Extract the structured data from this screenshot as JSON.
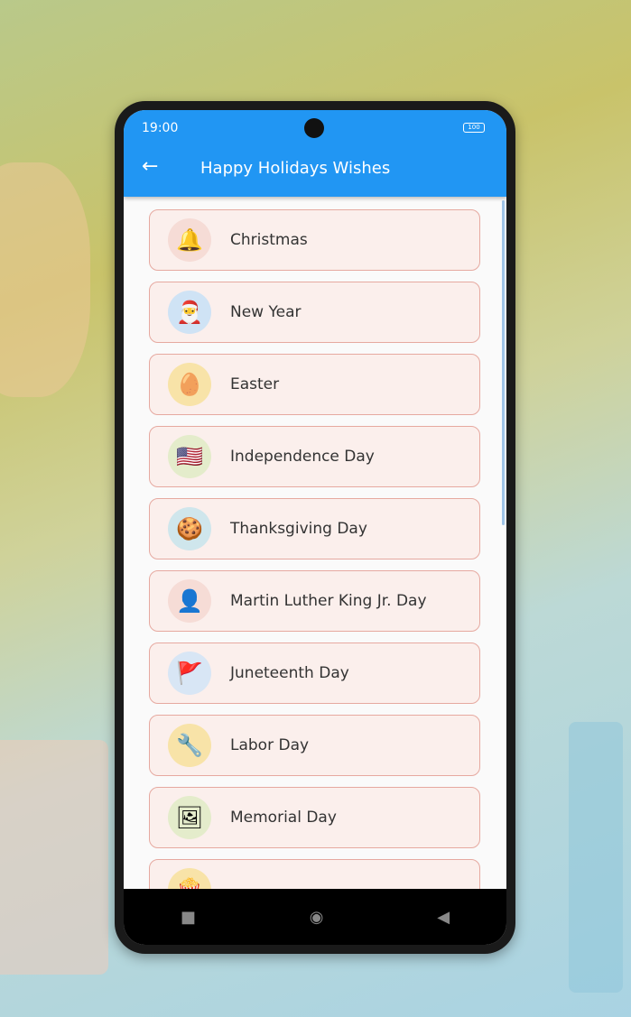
{
  "status_bar": {
    "time": "19:00",
    "battery": "100"
  },
  "app_bar": {
    "title": "Happy Holidays Wishes",
    "back_icon": "arrow-left-icon"
  },
  "colors": {
    "primary": "#2196F3",
    "card_bg": "#fbefec",
    "card_border": "#e6a9a0"
  },
  "items": [
    {
      "label": "Christmas",
      "icon": "bell-icon",
      "glyph": "🔔",
      "bg": "#f6dcd6"
    },
    {
      "label": "New Year",
      "icon": "santa-icon",
      "glyph": "🎅",
      "bg": "#cfe3f5"
    },
    {
      "label": "Easter",
      "icon": "easter-egg-icon",
      "glyph": "🥚",
      "bg": "#f8e3a8"
    },
    {
      "label": "Independence Day",
      "icon": "flag-heart-icon",
      "glyph": "🇺🇸",
      "bg": "#e4eccb"
    },
    {
      "label": "Thanksgiving Day",
      "icon": "thanks-badge-icon",
      "glyph": "🍪",
      "bg": "#cfe6ec"
    },
    {
      "label": "Martin Luther King Jr. Day",
      "icon": "portrait-icon",
      "glyph": "👤",
      "bg": "#f6dcd6"
    },
    {
      "label": "Juneteenth Day",
      "icon": "juneteenth-flag-icon",
      "glyph": "🚩",
      "bg": "#d8e6f5"
    },
    {
      "label": "Labor Day",
      "icon": "wrench-badge-icon",
      "glyph": "🔧",
      "bg": "#f8e3a8"
    },
    {
      "label": "Memorial Day",
      "icon": "picture-frame-icon",
      "glyph": "🖼",
      "bg": "#e4eccb"
    },
    {
      "label": "",
      "icon": "popcorn-icon",
      "glyph": "🍿",
      "bg": "#f8e3a8"
    }
  ],
  "nav": {
    "recent": "■",
    "home": "◉",
    "back": "◀"
  }
}
